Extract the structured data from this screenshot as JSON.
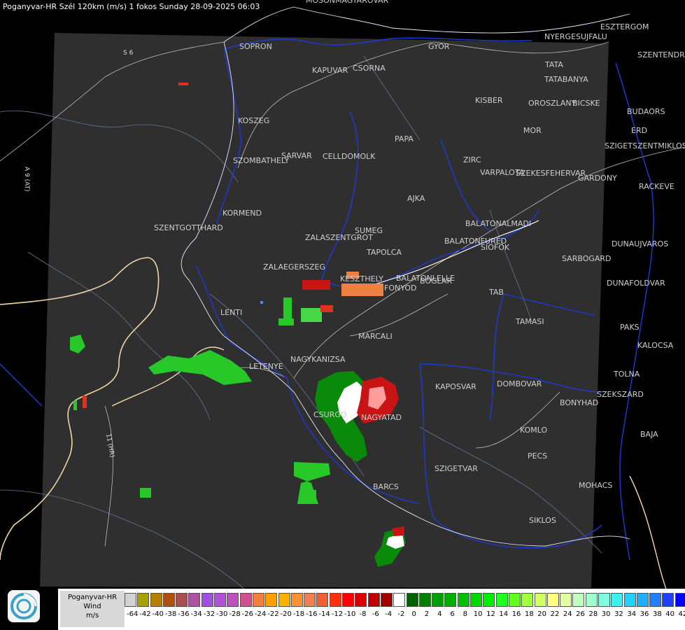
{
  "title": "Poganyvar-HR Szél 120km (m/s) 1 fokos Sunday 28-09-2025 06:03",
  "legend": {
    "product_name": "Poganyvar-HR",
    "quantity": "Wind",
    "unit": "m/s",
    "ticks": [
      "-64",
      "-42",
      "-40",
      "-38",
      "-36",
      "-34",
      "-32",
      "-30",
      "-28",
      "-26",
      "-24",
      "-22",
      "-20",
      "-18",
      "-16",
      "-14",
      "-12",
      "-10",
      "-8",
      "-6",
      "-4",
      "-2",
      "0",
      "2",
      "4",
      "6",
      "8",
      "10",
      "12",
      "14",
      "16",
      "18",
      "20",
      "22",
      "24",
      "26",
      "28",
      "30",
      "32",
      "34",
      "36",
      "38",
      "40",
      "42"
    ],
    "colors": [
      "#d2d2d2",
      "#a8a000",
      "#b58000",
      "#b05010",
      "#a85050",
      "#b050a0",
      "#a050e0",
      "#b050d8",
      "#c050c0",
      "#d05090",
      "#f08040",
      "#ffa000",
      "#ffb000",
      "#ff9030",
      "#f08050",
      "#f06030",
      "#ff3010",
      "#ff0000",
      "#d80000",
      "#c00000",
      "#a00000",
      "#ffffff",
      "#006000",
      "#008000",
      "#00a000",
      "#00b000",
      "#00c000",
      "#00d800",
      "#00f000",
      "#20ff20",
      "#60ff20",
      "#a0ff40",
      "#d0ff60",
      "#ffff80",
      "#e0ffa0",
      "#c0ffc0",
      "#a0ffd0",
      "#80ffe0",
      "#40f0f0",
      "#20d0ff",
      "#20b0ff",
      "#2080ff",
      "#2040ff",
      "#0000ff"
    ]
  },
  "cities": [
    {
      "name": "SOPRON"
    },
    {
      "name": "KAPUVAR"
    },
    {
      "name": "CSORNA"
    },
    {
      "name": "GYOR"
    },
    {
      "name": "TATA"
    },
    {
      "name": "TATABANYA"
    },
    {
      "name": "KISBER"
    },
    {
      "name": "OROSZLANY"
    },
    {
      "name": "BICSKE"
    },
    {
      "name": "KOSZEG"
    },
    {
      "name": "SZOMBATHELY"
    },
    {
      "name": "SARVAR"
    },
    {
      "name": "CELLDOMOLK"
    },
    {
      "name": "PAPA"
    },
    {
      "name": "ZIRC"
    },
    {
      "name": "MOR"
    },
    {
      "name": "VARPALOTA"
    },
    {
      "name": "SZEKESFEHERVAR"
    },
    {
      "name": "GARDONY"
    },
    {
      "name": "AJKA"
    },
    {
      "name": "KORMEND"
    },
    {
      "name": "SZENTGOTTHARD"
    },
    {
      "name": "ZALASZENTGROT"
    },
    {
      "name": "SUMEG"
    },
    {
      "name": "BALATONALMADI"
    },
    {
      "name": "BALATONFURED"
    },
    {
      "name": "SIOFOK"
    },
    {
      "name": "TAPOLCA"
    },
    {
      "name": "ZALAEGERSZEG"
    },
    {
      "name": "KESZTHELY"
    },
    {
      "name": "BALATONLELLE"
    },
    {
      "name": "FONYOD"
    },
    {
      "name": "BOGLAR"
    },
    {
      "name": "TAB"
    },
    {
      "name": "SARBOGARD"
    },
    {
      "name": "LENTI"
    },
    {
      "name": "TAMASI"
    },
    {
      "name": "MARCALI"
    },
    {
      "name": "NAGYKANIZSA"
    },
    {
      "name": "LETENYE"
    },
    {
      "name": "KAPOSVAR"
    },
    {
      "name": "DOMBOVAR"
    },
    {
      "name": "BONYHAD"
    },
    {
      "name": "SZEKSZARD"
    },
    {
      "name": "CSURGO"
    },
    {
      "name": "NAGYATAD"
    },
    {
      "name": "KOMLO"
    },
    {
      "name": "PECS"
    },
    {
      "name": "SZIGETVAR"
    },
    {
      "name": "MOHACS"
    },
    {
      "name": "BARCS"
    },
    {
      "name": "SIKLOS"
    },
    {
      "name": "DUNAUJVAROS"
    },
    {
      "name": "DUNAFOLDVAR"
    },
    {
      "name": "PAKS"
    },
    {
      "name": "KALOCSA"
    },
    {
      "name": "TOLNA"
    },
    {
      "name": "BAJA"
    },
    {
      "name": "BUDAORS"
    },
    {
      "name": "ERD"
    },
    {
      "name": "SZIGETSZENTMIKLOS"
    },
    {
      "name": "RACKEVE"
    },
    {
      "name": "ESZTERGOM"
    },
    {
      "name": "SZENTENDRE"
    },
    {
      "name": "NYERGESUJFALU"
    },
    {
      "name": "MOSONMAGYAROVAR"
    }
  ],
  "roads": [
    {
      "name": "S 6"
    },
    {
      "name": "A 9 (AT)"
    },
    {
      "name": "11 (HR)"
    }
  ]
}
